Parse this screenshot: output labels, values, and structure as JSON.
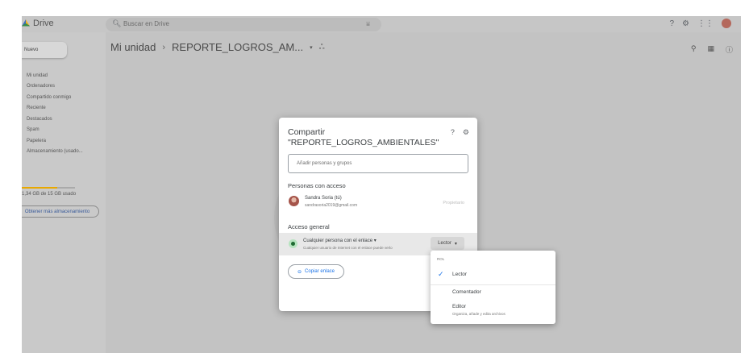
{
  "topbar": {
    "app_name": "Drive",
    "search_placeholder": "Buscar en Drive",
    "search_filter_icon": "⩸",
    "icons": [
      "help-icon",
      "settings-icon",
      "apps-icon"
    ]
  },
  "sidebar": {
    "new_label": "Nuevo",
    "items": [
      {
        "label": "Mi unidad"
      },
      {
        "label": "Ordenadores"
      },
      {
        "label": "Compartido conmigo"
      },
      {
        "label": "Reciente"
      },
      {
        "label": "Destacados"
      },
      {
        "label": "Spam"
      },
      {
        "label": "Papelera"
      },
      {
        "label": "Almacenamiento (usado..."
      }
    ],
    "storage_text": "1,34 GB de 15 GB usado",
    "get_more_label": "Obtener más almacenamiento"
  },
  "main": {
    "breadcrumb_root": "Mi unidad",
    "breadcrumb_sep": "›",
    "breadcrumb_folder": "REPORTE_LOGROS_AM...",
    "breadcrumb_arrow": "▾",
    "breadcrumb_people": "ஃ"
  },
  "dialog": {
    "title_line1": "Compartir",
    "title_line2": "\"REPORTE_LOGROS_AMBIENTALES\"",
    "add_placeholder": "Añadir personas y grupos",
    "people_title": "Personas con acceso",
    "person": {
      "name": "Sandra Soria (tú)",
      "email": "sandrasoria2019@gmail.com",
      "role": "Propietario"
    },
    "general_title": "Acceso general",
    "access": {
      "label": "Cualquier persona con el enlace",
      "arrow": "▾",
      "description": "Cualquier usuario de Internet con el enlace puede verlo",
      "role": "Lector",
      "role_arrow": "▾"
    },
    "copy_link_label": "Copiar enlace"
  },
  "role_dropdown": {
    "header": "ROL",
    "check": "✓",
    "items": [
      {
        "label": "Lector",
        "selected": true
      },
      {
        "label": "Comentador",
        "selected": false
      },
      {
        "label": "Editor",
        "description": "Organiza, añade y edita archivos",
        "selected": false
      }
    ]
  },
  "colors": {
    "accent": "#1a73e8",
    "storage_fill": "#e8a800"
  }
}
